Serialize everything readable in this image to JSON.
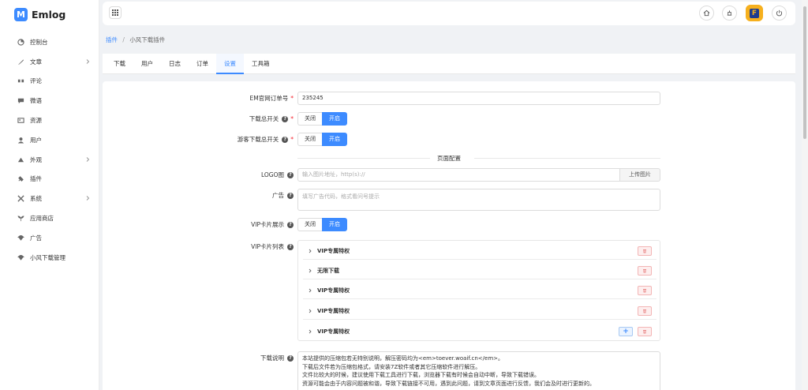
{
  "brand": {
    "name": "Emlog",
    "logo_letter": "M"
  },
  "sidebar": {
    "items": [
      {
        "label": "控制台",
        "icon": "dashboard-icon",
        "has_submenu": false
      },
      {
        "label": "文章",
        "icon": "feather-icon",
        "has_submenu": true
      },
      {
        "label": "评论",
        "icon": "quote-icon",
        "has_submenu": false
      },
      {
        "label": "微语",
        "icon": "chat-icon",
        "has_submenu": false
      },
      {
        "label": "资源",
        "icon": "image-icon",
        "has_submenu": false
      },
      {
        "label": "用户",
        "icon": "user-icon",
        "has_submenu": false
      },
      {
        "label": "外观",
        "icon": "palette-icon",
        "has_submenu": true
      },
      {
        "label": "插件",
        "icon": "plug-icon",
        "has_submenu": false
      },
      {
        "label": "系统",
        "icon": "tools-icon",
        "has_submenu": true
      },
      {
        "label": "应用商店",
        "icon": "sprout-icon",
        "has_submenu": false
      },
      {
        "label": "广告",
        "icon": "parachute-icon",
        "has_submenu": false
      },
      {
        "label": "小风下载管理",
        "icon": "parachute-icon",
        "has_submenu": false
      }
    ]
  },
  "topbar": {
    "icons": [
      "home-icon",
      "sync-icon",
      "avatar",
      "power-icon"
    ],
    "avatar_letter": "F"
  },
  "breadcrumb": {
    "parent": "插件",
    "separator": "/",
    "current": "小风下载插件"
  },
  "tabs": {
    "items": [
      {
        "label": "下载"
      },
      {
        "label": "用户"
      },
      {
        "label": "日志"
      },
      {
        "label": "订单"
      },
      {
        "label": "设置"
      },
      {
        "label": "工具箱"
      }
    ],
    "active_index": 4
  },
  "form": {
    "order_no": {
      "label": "EM官网订单号",
      "required_mark": "*",
      "value": "235245"
    },
    "download_switch": {
      "label": "下载总开关",
      "required_mark": "*",
      "off": "关闭",
      "on": "开启",
      "selected": "开启"
    },
    "guest_switch": {
      "label": "游客下载总开关",
      "required_mark": "*",
      "off": "关闭",
      "on": "开启",
      "selected": "开启"
    },
    "section_title": "页面配置",
    "logo": {
      "label": "LOGO图",
      "placeholder": "输入图片地址，http(s)://",
      "upload_button": "上传图片"
    },
    "ad": {
      "label": "广告",
      "placeholder": "填写广告代码，格式看问号提示"
    },
    "vip_display": {
      "label": "VIP卡片展示",
      "off": "关闭",
      "on": "开启",
      "selected": "开启"
    },
    "vip_list": {
      "label": "VIP卡片列表",
      "items": [
        {
          "title": "VIP专属特权"
        },
        {
          "title": "无限下载"
        },
        {
          "title": "VIP专属特权"
        },
        {
          "title": "VIP专属特权"
        },
        {
          "title": "VIP专属特权"
        }
      ],
      "add_symbol": "+"
    },
    "download_desc": {
      "label": "下载说明",
      "lines": [
        "本站提供的压缩包若无特别说明，解压密码均为<em>toever.woaif.cn</em>。",
        "下载后文件若为压缩包格式，请安装7Z软件或者其它压缩软件进行解压。",
        "文件比较大的时候，建议使用下载工具进行下载，浏览器下载有时候会自动中断，导致下载错误。",
        "资源可能会由于内容问题被和谐，导致下载链接不可用，遇到此问题，请到文章页面进行反馈，我们会及时进行更新的。"
      ]
    }
  },
  "colors": {
    "accent": "#3d8bff",
    "danger": "#f5222d",
    "avatar_bg": "#f6b01e"
  }
}
